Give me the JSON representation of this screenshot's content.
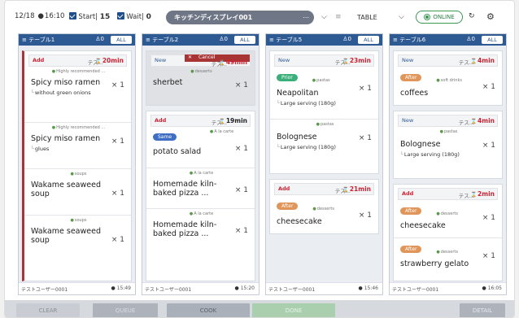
{
  "header": {
    "date": "12/18",
    "time": "16:10",
    "start_label": "Start",
    "start_count": "15",
    "wait_label": "Wait",
    "wait_count": "0",
    "display_name": "キッチンディスプレイ001",
    "ellipsis": "...",
    "layout": "TABLE",
    "status": "ONLINE"
  },
  "columns": [
    {
      "title": "テーブル1",
      "count": "0",
      "all": "ALL",
      "user": "テストユーザー0001",
      "time": "15:49",
      "card": {
        "badge": "Add",
        "name": "テス...",
        "minutes": "20min",
        "items": [
          {
            "category": "Highly recommended ...",
            "name": "Spicy miso ramen",
            "qty": "× 1",
            "option": "without green onions"
          },
          {
            "category": "Highly recommended ...",
            "name": "Spicy miso ramen",
            "qty": "× 1",
            "option": "glues"
          },
          {
            "category": "soups",
            "name": "Wakame seaweed soup",
            "qty": "× 1"
          },
          {
            "category": "soups",
            "name": "Wakame seaweed soup",
            "qty": "× 1"
          }
        ]
      }
    },
    {
      "title": "テーブル2",
      "count": "0",
      "all": "ALL",
      "user": "テストユーザー0001",
      "time": "15:20",
      "card1": {
        "badge": "New",
        "name": "テス...",
        "minutes": "49min",
        "cancel": "Cancel",
        "items": [
          {
            "category": "desserts",
            "name": "sherbet",
            "qty": "× 1"
          }
        ]
      },
      "card2": {
        "badge": "Add",
        "name": "テス...",
        "minutes": "19min",
        "items": [
          {
            "category": "A la carte",
            "pill": "Same",
            "name": "potato salad",
            "qty": "× 1"
          },
          {
            "category": "A la carte",
            "name": "Homemade kiln-baked pizza ...",
            "qty": "× 1"
          },
          {
            "category": "A la carte",
            "name": "Homemade kiln-baked pizza ...",
            "qty": "× 1"
          }
        ]
      }
    },
    {
      "title": "テーブル5",
      "count": "0",
      "all": "ALL",
      "user": "テストユーザー0001",
      "time": "15:46",
      "card1": {
        "badge": "New",
        "name": "テス...",
        "minutes": "23min",
        "items": [
          {
            "pill": "Prior",
            "category": "pastas",
            "name": "Neapolitan",
            "qty": "× 1",
            "option": "Large serving (180g)"
          },
          {
            "category": "pastas",
            "name": "Bolognese",
            "qty": "× 1",
            "option": "Large serving (180g)"
          }
        ]
      },
      "card2": {
        "badge": "Add",
        "name": "テス...",
        "minutes": "21min",
        "items": [
          {
            "pill": "After",
            "category": "desserts",
            "name": "cheesecake",
            "qty": "× 1"
          }
        ]
      }
    },
    {
      "title": "テーブル6",
      "count": "0",
      "all": "ALL",
      "user": "テストユーザー0001",
      "time": "16:05",
      "card1": {
        "badge": "New",
        "name": "テス...",
        "minutes": "4min",
        "items": [
          {
            "pill": "After",
            "category": "soft drinks",
            "name": "coffees",
            "qty": "× 1"
          }
        ]
      },
      "card2": {
        "badge": "New",
        "name": "テス...",
        "minutes": "4min",
        "items": [
          {
            "category": "pastas",
            "name": "Bolognese",
            "qty": "× 1",
            "option": "Large serving (180g)"
          }
        ]
      },
      "card3": {
        "badge": "Add",
        "name": "テス...",
        "minutes": "2min",
        "items": [
          {
            "pill": "After",
            "category": "desserts",
            "name": "cheesecake",
            "qty": "× 1"
          },
          {
            "pill": "After",
            "category": "desserts",
            "name": "strawberry gelato",
            "qty": "× 1"
          }
        ]
      }
    }
  ],
  "actions": {
    "clear": "CLEAR",
    "queue": "QUEUE",
    "cook": "COOK",
    "done": "DONE",
    "detail": "DETAIL"
  },
  "colors": {
    "header_blue": "#2e5a94",
    "add_red": "#c23",
    "online_green": "#3a9a54",
    "prior": "#3aaf7a",
    "after": "#e0965a",
    "same": "#3e6fc4"
  }
}
